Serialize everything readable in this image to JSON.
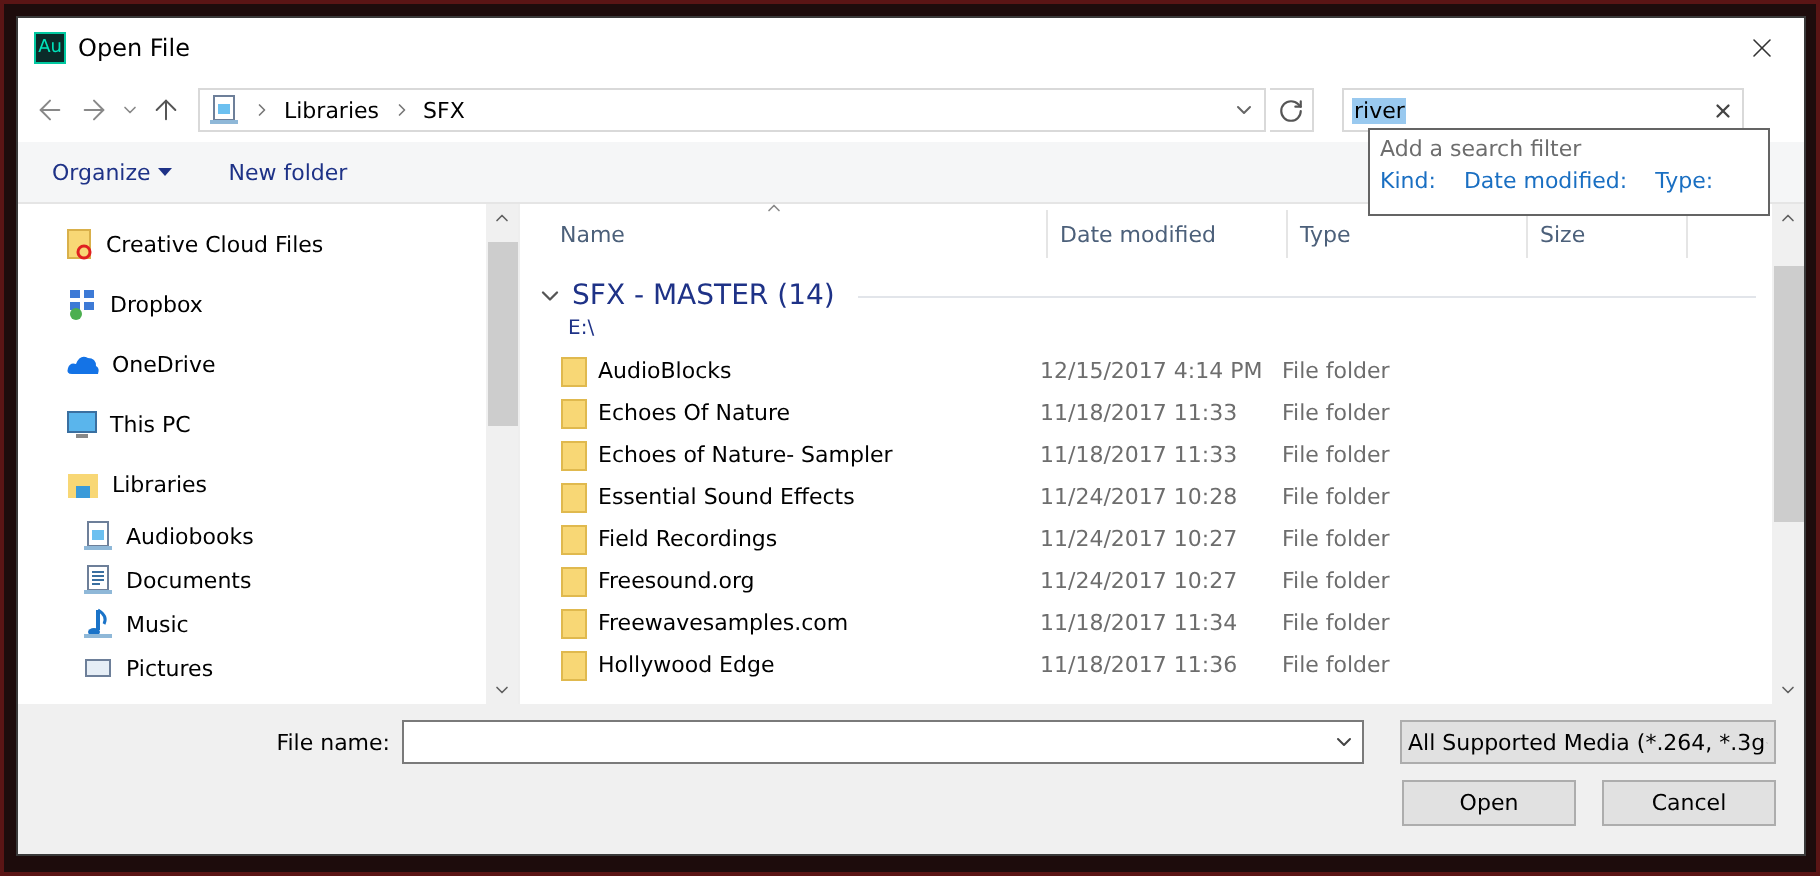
{
  "window": {
    "app_badge": "Au",
    "title": "Open File"
  },
  "address": {
    "breadcrumb": [
      "Libraries",
      "SFX"
    ]
  },
  "search": {
    "value": "river",
    "suggestions": {
      "heading": "Add a search filter",
      "filters": [
        "Kind:",
        "Date modified:",
        "Type:"
      ]
    }
  },
  "toolbar": [
    {
      "label": "Organize",
      "kind": "menu"
    },
    {
      "label": "New folder",
      "kind": "button"
    }
  ],
  "sidebar": {
    "items": [
      {
        "label": "Creative Cloud Files"
      },
      {
        "label": "Dropbox"
      },
      {
        "label": "OneDrive"
      },
      {
        "label": "This PC"
      },
      {
        "label": "Libraries",
        "children": [
          {
            "label": "Audiobooks"
          },
          {
            "label": "Documents"
          },
          {
            "label": "Music"
          },
          {
            "label": "Pictures"
          }
        ]
      }
    ]
  },
  "table": {
    "columns": [
      {
        "label": "Name",
        "sorted": true
      },
      {
        "label": "Date modified",
        "sorted": false
      },
      {
        "label": "Type",
        "sorted": false
      },
      {
        "label": "Size",
        "sorted": false
      }
    ],
    "group": {
      "title": "SFX - MASTER (14)",
      "subtitle": "E:\\",
      "expanded": true,
      "rows": [
        {
          "name": "AudioBlocks",
          "date": "12/15/2017 4:14 PM",
          "type": "File folder"
        },
        {
          "name": "Echoes Of Nature",
          "date": "11/18/2017 11:33",
          "type": "File folder"
        },
        {
          "name": "Echoes of Nature- Sampler",
          "date": "11/18/2017 11:33",
          "type": "File folder"
        },
        {
          "name": "Essential Sound Effects",
          "date": "11/24/2017 10:28",
          "type": "File folder"
        },
        {
          "name": "Field Recordings",
          "date": "11/24/2017 10:27",
          "type": "File folder"
        },
        {
          "name": "Freesound.org",
          "date": "11/24/2017 10:27",
          "type": "File folder"
        },
        {
          "name": "Freewavesamples.com",
          "date": "11/18/2017 11:34",
          "type": "File folder"
        },
        {
          "name": "Hollywood Edge",
          "date": "11/18/2017 11:36",
          "type": "File folder"
        }
      ]
    }
  },
  "footer": {
    "file_name_label": "File name:",
    "file_type": "All Supported Media (*.264, *.3g",
    "buttons": [
      "Open",
      "Cancel"
    ]
  }
}
